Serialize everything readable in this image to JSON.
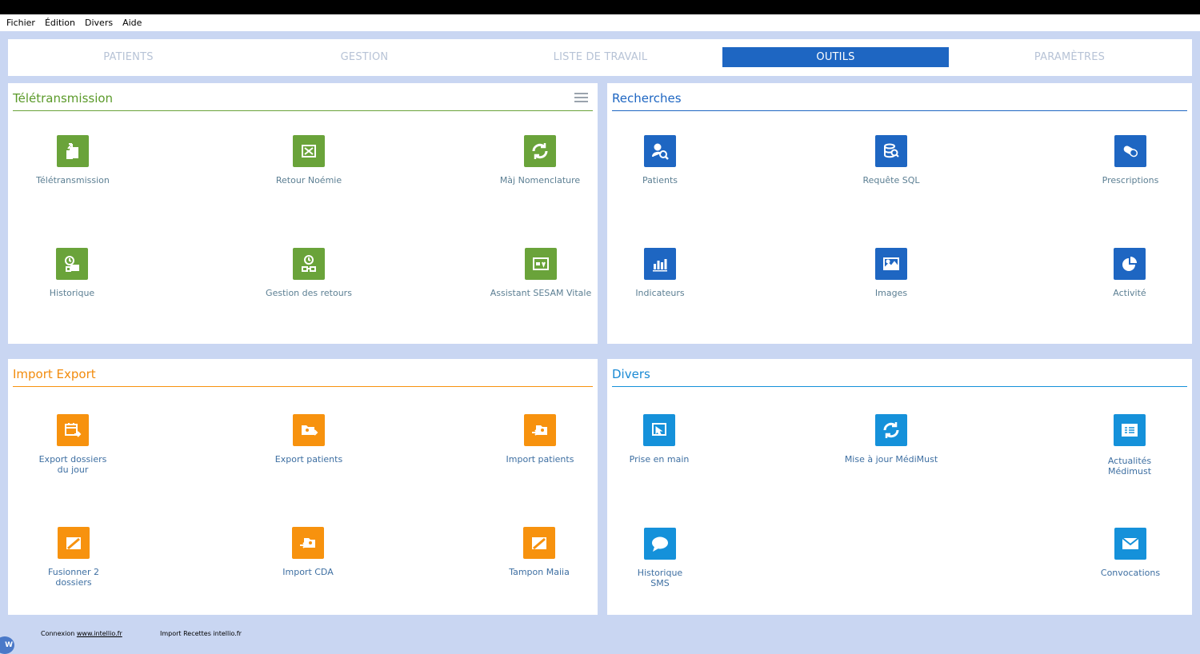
{
  "menu": [
    "Fichier",
    "Édition",
    "Divers",
    "Aide"
  ],
  "tabs": [
    {
      "label": "PATIENTS",
      "active": false
    },
    {
      "label": "GESTION",
      "active": false
    },
    {
      "label": "LISTE DE TRAVAIL",
      "active": false
    },
    {
      "label": "OUTILS",
      "active": true
    },
    {
      "label": "PARAMÈTRES",
      "active": false
    }
  ],
  "colors": {
    "accent": "#1e66c2",
    "teletransmission": "#6aa33a",
    "recherches": "#1e66c2",
    "import_export": "#f7920e",
    "divers": "#1591da",
    "background": "#c9d6f2"
  },
  "panels": {
    "teletransmission": {
      "title": "Télétransmission",
      "items": [
        {
          "label": "Télétransmission",
          "icon": "transfer-files-icon"
        },
        {
          "label": "Retour Noémie",
          "icon": "return-icon"
        },
        {
          "label": "Màj Nomenclature",
          "icon": "refresh-icon"
        },
        {
          "label": "Historique",
          "icon": "history-icon"
        },
        {
          "label": "Gestion des retours",
          "icon": "returns-management-icon"
        },
        {
          "label": "Assistant SESAM Vitale",
          "icon": "card-reader-icon"
        }
      ]
    },
    "recherches": {
      "title": "Recherches",
      "items": [
        {
          "label": "Patients",
          "icon": "user-search-icon"
        },
        {
          "label": "Requête SQL",
          "icon": "database-search-icon"
        },
        {
          "label": "Prescriptions",
          "icon": "pill-icon"
        },
        {
          "label": "Indicateurs",
          "icon": "bar-chart-icon"
        },
        {
          "label": "Images",
          "icon": "image-icon"
        },
        {
          "label": "Activité",
          "icon": "pie-chart-icon"
        }
      ]
    },
    "import_export": {
      "title": "Import Export",
      "items": [
        {
          "label_lines": [
            "Export dossiers",
            "du jour"
          ],
          "icon": "calendar-export-icon"
        },
        {
          "label_lines": [
            "Export patients"
          ],
          "icon": "folder-export-icon"
        },
        {
          "label_lines": [
            "Import patients"
          ],
          "icon": "folder-import-icon"
        },
        {
          "label_lines": [
            "Fusionner 2",
            "dossiers"
          ],
          "icon": "merge-folder-icon"
        },
        {
          "label_lines": [
            "Import CDA"
          ],
          "icon": "folder-import-cda-icon"
        },
        {
          "label_lines": [
            "Tampon Maiia"
          ],
          "icon": "stamp-folder-icon"
        }
      ]
    },
    "divers": {
      "title": "Divers",
      "items": [
        {
          "label_lines": [
            "Prise en main"
          ],
          "icon": "remote-control-icon"
        },
        {
          "label_lines": [
            "Mise à jour MédiMust"
          ],
          "icon": "update-icon"
        },
        {
          "label_lines": [
            "Actualités",
            "Médimust"
          ],
          "icon": "news-icon"
        },
        {
          "label_lines": [
            "Historique",
            "SMS"
          ],
          "icon": "chat-bubble-icon"
        },
        {
          "label_lines": [
            "Convocations"
          ],
          "icon": "envelope-icon"
        }
      ]
    }
  },
  "footer": {
    "connexion_prefix": "Connexion",
    "connexion_link": "www.intellio.fr",
    "import_recettes": "Import Recettes intellio.fr",
    "logo_letter": "W"
  }
}
